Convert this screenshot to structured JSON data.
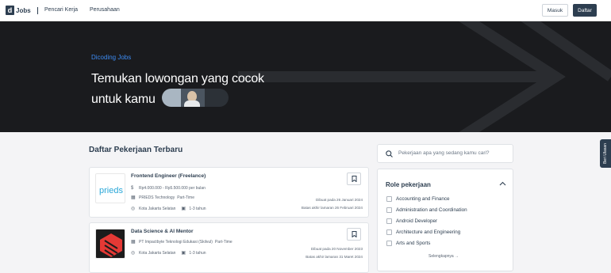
{
  "header": {
    "logo_letter": "d",
    "logo_text": "Jobs",
    "nav": [
      "Pencari Kerja",
      "Perusahaan"
    ],
    "login_label": "Masuk",
    "register_label": "Daftar"
  },
  "hero": {
    "kicker": "Dicoding Jobs",
    "title_line1": "Temukan lowongan yang cocok",
    "title_line2": "untuk kamu"
  },
  "side_tab": "Beri Ulasan",
  "jobs_section_title": "Daftar Pekerjaan Terbaru",
  "jobs": [
    {
      "title": "Frontend Engineer (Freelance)",
      "salary": "Rp4.000.000 - Rp5.500.000 per bulan",
      "company": "PRIEDS Technology",
      "type": "Part-Time",
      "location": "Kota Jakarta Selatan",
      "experience": "1-3 tahun",
      "posted": "Dibuat pada 26 Januari 2024",
      "deadline": "Batas akhir lamaran 26 Februari 2024",
      "logo_text": "prieds"
    },
    {
      "title": "Data Science & AI Mentor",
      "company": "PT Impactbyte Teknologi Edukasi (Skilvul)",
      "type": "Part-Time",
      "location": "Kota Jakarta Selatan",
      "experience": "1-3 tahun",
      "posted": "Dibuat pada 20 November 2023",
      "deadline": "Batas akhir lamaran 31 Maret 2024"
    }
  ],
  "search": {
    "placeholder": "Pekerjaan apa yang sedang kamu cari?"
  },
  "filter": {
    "title": "Role pekerjaan",
    "items": [
      "Accounting and Finance",
      "Administration and Coordination",
      "Android Developer",
      "Architecture and Engineering",
      "Arts and Sports"
    ],
    "see_more": "Selengkapnya"
  },
  "colors": {
    "brand_dark": "#2d3e50",
    "accent_blue": "#3d8bf2",
    "hero_bg": "#1a1b1e",
    "skilvul_red": "#e53935"
  }
}
